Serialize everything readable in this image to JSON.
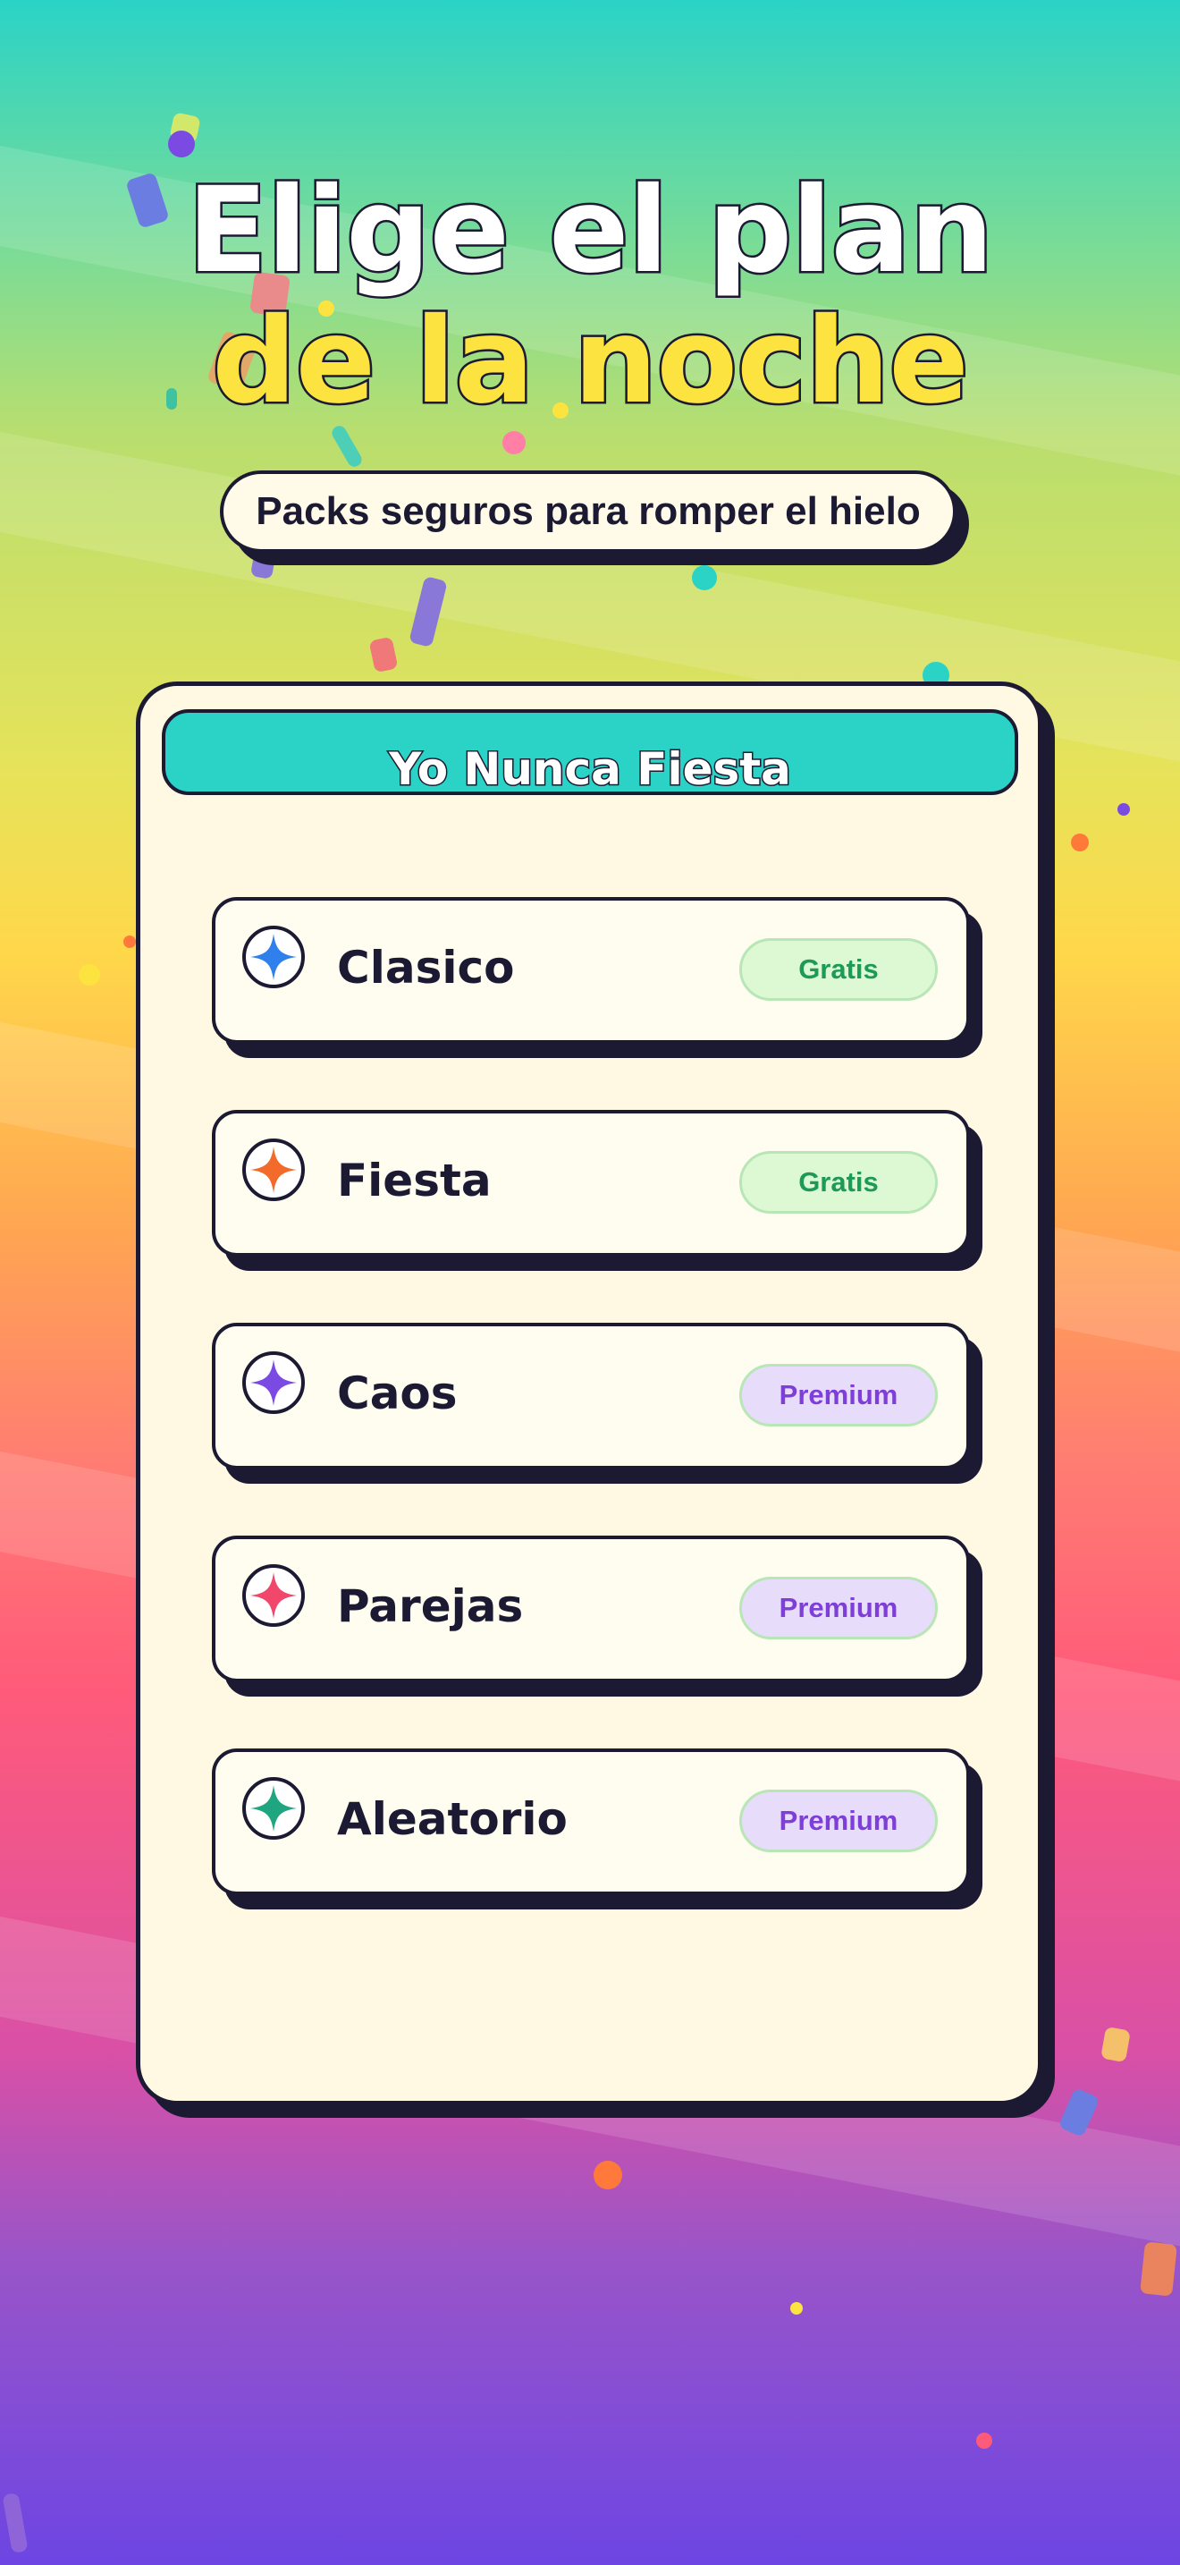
{
  "header": {
    "title_line1": "Elige el plan",
    "title_line2": "de la noche",
    "subtitle": "Packs seguros para romper el hielo"
  },
  "card": {
    "title": "Yo Nunca Fiesta",
    "packs": [
      {
        "label": "Clasico",
        "badge": "Gratis",
        "tier": "free",
        "icon": "sparkle-icon",
        "icon_color": "#2f80ed"
      },
      {
        "label": "Fiesta",
        "badge": "Gratis",
        "tier": "free",
        "icon": "sparkle-icon",
        "icon_color": "#f26b2a"
      },
      {
        "label": "Caos",
        "badge": "Premium",
        "tier": "premium",
        "icon": "sparkle-icon",
        "icon_color": "#7b4ae2"
      },
      {
        "label": "Parejas",
        "badge": "Premium",
        "tier": "premium",
        "icon": "sparkle-icon",
        "icon_color": "#f0476b"
      },
      {
        "label": "Aleatorio",
        "badge": "Premium",
        "tier": "premium",
        "icon": "sparkle-icon",
        "icon_color": "#1fa57f"
      }
    ]
  },
  "colors": {
    "outline": "#1c1a33",
    "accent_teal": "#2ad3c6",
    "title_yellow": "#fde33f",
    "free_badge_bg": "#ddf9d4",
    "free_badge_text": "#1d9a57",
    "premium_badge_bg": "#e8dcfb",
    "premium_badge_text": "#7e3fd9"
  }
}
